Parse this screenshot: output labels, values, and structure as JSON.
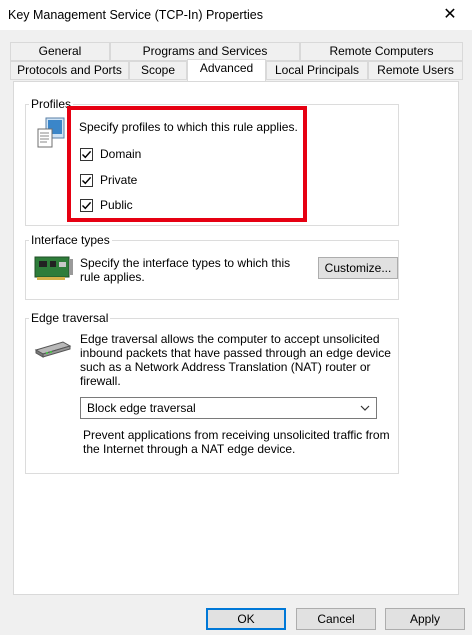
{
  "window": {
    "title": "Key Management Service (TCP-In) Properties",
    "close_symbol": "✕"
  },
  "tabs": {
    "row1": [
      "General",
      "Programs and Services",
      "Remote Computers"
    ],
    "row2": [
      "Protocols and Ports",
      "Scope",
      "Advanced",
      "Local Principals",
      "Remote Users"
    ],
    "active": "Advanced"
  },
  "profiles": {
    "label": "Profiles",
    "description": "Specify profiles to which this rule applies.",
    "options": [
      {
        "label": "Domain",
        "checked": true
      },
      {
        "label": "Private",
        "checked": true
      },
      {
        "label": "Public",
        "checked": true
      }
    ],
    "icon": "profiles-computer-icon"
  },
  "interface_types": {
    "label": "Interface types",
    "description_line1": "Specify the interface types to which this",
    "description_line2": "rule applies.",
    "button_label": "Customize...",
    "icon": "network-card-icon"
  },
  "edge_traversal": {
    "label": "Edge traversal",
    "description_lines": [
      "Edge traversal allows the computer to accept unsolicited",
      "inbound packets that have passed through an edge device",
      "such as a Network Address Translation (NAT) router or",
      "firewall."
    ],
    "select_value": "Block edge traversal",
    "help_line1": "Prevent applications from receiving unsolicited traffic from",
    "help_line2": "the Internet through a NAT edge device.",
    "icon": "edge-router-icon"
  },
  "footer": {
    "ok_label": "OK",
    "cancel_label": "Cancel",
    "apply_label": "Apply"
  },
  "colors": {
    "highlight": "#e60012",
    "default_button_border": "#0078d7"
  }
}
